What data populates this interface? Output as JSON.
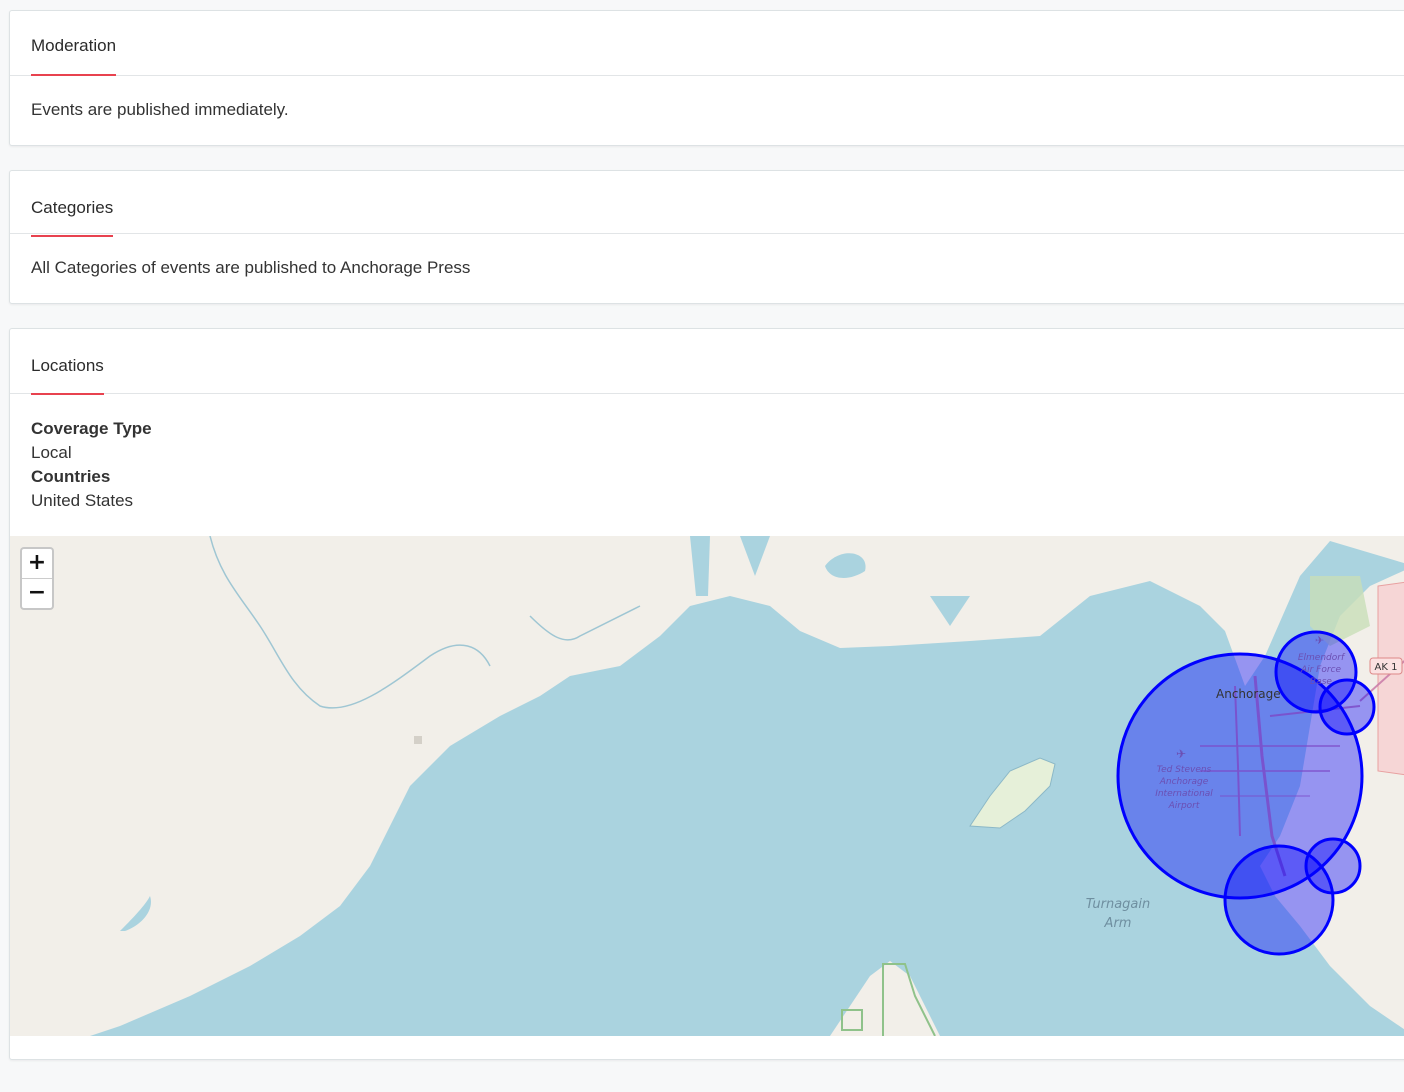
{
  "moderation": {
    "title": "Moderation",
    "text": "Events are published immediately."
  },
  "categories": {
    "title": "Categories",
    "text": "All Categories of events are published to Anchorage Press"
  },
  "locations": {
    "title": "Locations",
    "coverage_label": "Coverage Type",
    "coverage_value": "Local",
    "countries_label": "Countries",
    "countries_value": "United States"
  },
  "map": {
    "zoom_in": "+",
    "zoom_out": "−",
    "labels": {
      "city": "Anchorage",
      "airport": [
        "Ted Stevens",
        "Anchorage",
        "International",
        "Airport"
      ],
      "base": [
        "Elmendorf",
        "Air Force",
        "Base"
      ],
      "water": [
        "Turnagain",
        "Arm"
      ],
      "road": "AK 1"
    },
    "colors": {
      "water": "#aad3df",
      "land": "#f2efe9",
      "circle_fill": "#0000ff",
      "circle_stroke": "#0000ff",
      "accent": "#e8424f"
    }
  }
}
